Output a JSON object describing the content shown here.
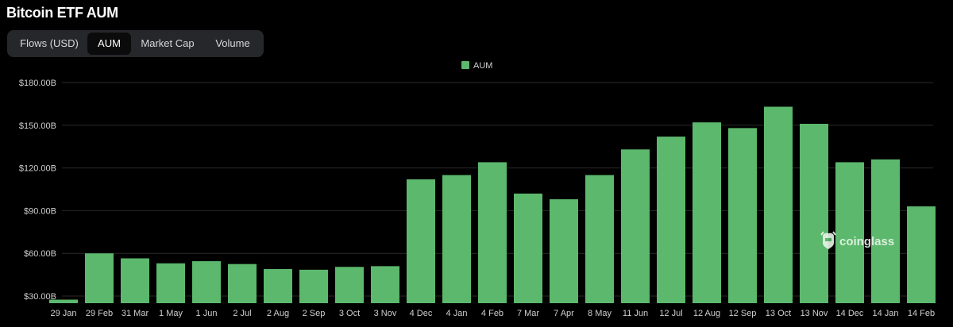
{
  "page": {
    "title": "Bitcoin ETF AUM"
  },
  "tabs": [
    {
      "label": "Flows (USD)",
      "active": false
    },
    {
      "label": "AUM",
      "active": true
    },
    {
      "label": "Market Cap",
      "active": false
    },
    {
      "label": "Volume",
      "active": false
    }
  ],
  "watermark": {
    "text": "coinglass",
    "icon": "coinglass-logo-icon"
  },
  "colors": {
    "background": "#000000",
    "bar": "#5cb86c",
    "gridline": "#2a2a2a",
    "tab_bg": "#26272b",
    "tab_active_bg": "#0b0b0c"
  },
  "chart_data": {
    "type": "bar",
    "title": "Bitcoin ETF AUM",
    "legend": {
      "entries": [
        "AUM"
      ],
      "placement": "top-center"
    },
    "series": [
      {
        "name": "AUM",
        "x": [
          "29 Jan",
          "29 Feb",
          "31 Mar",
          "1 May",
          "1 Jun",
          "2 Jul",
          "2 Aug",
          "2 Sep",
          "3 Oct",
          "3 Nov",
          "4 Dec",
          "4 Jan",
          "4 Feb",
          "7 Mar",
          "7 Apr",
          "8 May",
          "11 Jun",
          "12 Jul",
          "12 Aug",
          "12 Sep",
          "13 Oct",
          "13 Nov",
          "14 Dec",
          "14 Jan",
          "14 Feb"
        ],
        "values": [
          27.5,
          60.0,
          56.5,
          53.0,
          54.5,
          52.5,
          49.0,
          48.5,
          50.5,
          51.0,
          112.0,
          115.0,
          124.0,
          102.0,
          98.0,
          115.0,
          133.0,
          142.0,
          152.0,
          148.0,
          163.0,
          151.0,
          124.0,
          126.0,
          93.0
        ]
      }
    ],
    "xticks": [
      "29 Jan",
      "29 Feb",
      "31 Mar",
      "1 May",
      "1 Jun",
      "2 Jul",
      "2 Aug",
      "2 Sep",
      "3 Oct",
      "3 Nov",
      "4 Dec",
      "4 Jan",
      "4 Feb",
      "7 Mar",
      "7 Apr",
      "8 May",
      "11 Jun",
      "12 Jul",
      "12 Aug",
      "12 Sep",
      "13 Oct",
      "13 Nov",
      "14 Dec",
      "14 Jan",
      "14 Feb"
    ],
    "yticks": [
      "$30.00B",
      "$60.00B",
      "$90.00B",
      "$120.00B",
      "$150.00B",
      "$180.00B"
    ],
    "ytick_values": [
      30,
      60,
      90,
      120,
      150,
      180
    ],
    "ylim": [
      25,
      185
    ],
    "grid": true
  }
}
